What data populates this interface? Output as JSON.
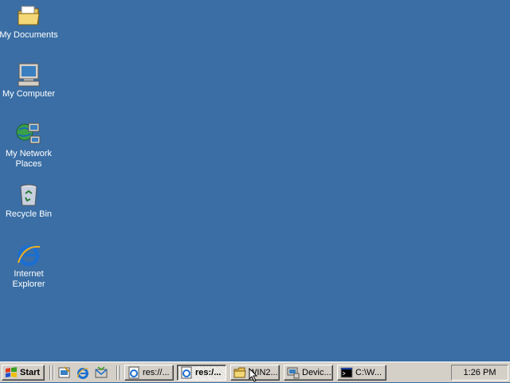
{
  "desktop": {
    "icons": [
      {
        "label": "My Documents",
        "icon": "my-documents-icon"
      },
      {
        "label": "My Computer",
        "icon": "my-computer-icon"
      },
      {
        "label": "My Network Places",
        "icon": "network-places-icon"
      },
      {
        "label": "Recycle Bin",
        "icon": "recycle-bin-icon"
      },
      {
        "label": "Internet Explorer",
        "icon": "internet-explorer-icon"
      }
    ]
  },
  "taskbar": {
    "start_label": "Start",
    "quick_launch": [
      "show-desktop-icon",
      "internet-explorer-icon",
      "outlook-express-icon"
    ],
    "tasks": [
      {
        "label": "res://...",
        "icon": "ie-page-icon",
        "active": false
      },
      {
        "label": "res:/...",
        "icon": "ie-page-icon",
        "active": true
      },
      {
        "label": "WIN2...",
        "icon": "folder-icon",
        "active": false
      },
      {
        "label": "Devic...",
        "icon": "device-manager-icon",
        "active": false
      },
      {
        "label": "C:\\W...",
        "icon": "command-prompt-icon",
        "active": false
      }
    ],
    "clock": "1:26 PM"
  },
  "colors": {
    "desktop": "#3a6ea5",
    "taskbar": "#d4d0c8"
  }
}
